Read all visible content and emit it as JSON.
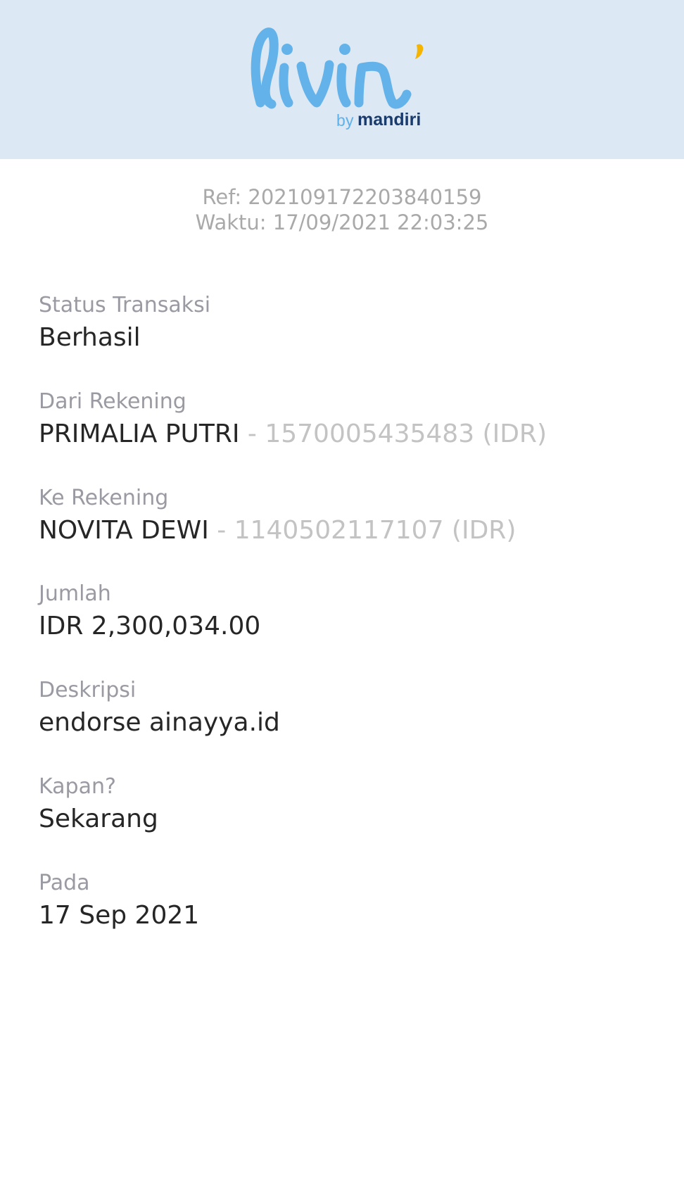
{
  "header": {
    "logo": {
      "by": "by",
      "brand": "mandiri",
      "wordmark_icon": "livin-wordmark-icon",
      "colors": {
        "wordmark": "#63b3ea",
        "accent": "#f5b400",
        "brand_text": "#1a3b6e",
        "background": "#dce8f4"
      }
    }
  },
  "meta": {
    "ref": "Ref: 202109172203840159",
    "time": "Waktu: 17/09/2021 22:03:25"
  },
  "fields": {
    "status": {
      "label": "Status Transaksi",
      "value": "Berhasil"
    },
    "from": {
      "label": "Dari Rekening",
      "name": "PRIMALIA PUTRI",
      "sep": " - ",
      "account": "1570005435483 (IDR)"
    },
    "to": {
      "label": "Ke Rekening",
      "name": "NOVITA DEWI",
      "sep": " - ",
      "account": "1140502117107 (IDR)"
    },
    "amount": {
      "label": "Jumlah",
      "value": "IDR 2,300,034.00"
    },
    "description": {
      "label": "Deskripsi",
      "value": "endorse ainayya.id"
    },
    "when": {
      "label": "Kapan?",
      "value": "Sekarang"
    },
    "on": {
      "label": "Pada",
      "value": "17 Sep 2021"
    }
  }
}
